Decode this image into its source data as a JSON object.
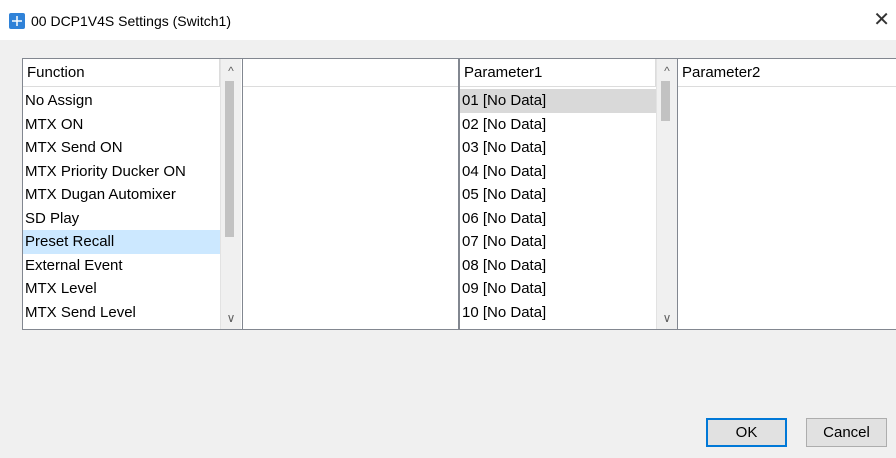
{
  "window": {
    "title": "00 DCP1V4S Settings (Switch1)",
    "close_glyph": "✕",
    "icon": "app-icon"
  },
  "function_list": {
    "header": "Function",
    "items": [
      {
        "label": "No Assign"
      },
      {
        "label": "MTX ON"
      },
      {
        "label": "MTX Send ON"
      },
      {
        "label": "MTX Priority Ducker ON"
      },
      {
        "label": "MTX Dugan Automixer"
      },
      {
        "label": "SD Play"
      },
      {
        "label": "Preset Recall",
        "selected": true
      },
      {
        "label": "External Event"
      },
      {
        "label": "MTX Level"
      },
      {
        "label": "MTX Send Level"
      }
    ],
    "selected_color": "#cce8ff"
  },
  "middle_list": {
    "header": ""
  },
  "parameter1_list": {
    "header": "Parameter1",
    "items": [
      {
        "label": "01 [No Data]",
        "selected": true
      },
      {
        "label": "02 [No Data]"
      },
      {
        "label": "03 [No Data]"
      },
      {
        "label": "04 [No Data]"
      },
      {
        "label": "05 [No Data]"
      },
      {
        "label": "06 [No Data]"
      },
      {
        "label": "07 [No Data]"
      },
      {
        "label": "08 [No Data]"
      },
      {
        "label": "09 [No Data]"
      },
      {
        "label": "10 [No Data]"
      }
    ],
    "selected_color": "#d9d9d9"
  },
  "parameter2_list": {
    "header": "Parameter2"
  },
  "scrollbar": {
    "up_glyph": "^",
    "down_glyph": "∨"
  },
  "buttons": {
    "ok": "OK",
    "cancel": "Cancel"
  }
}
